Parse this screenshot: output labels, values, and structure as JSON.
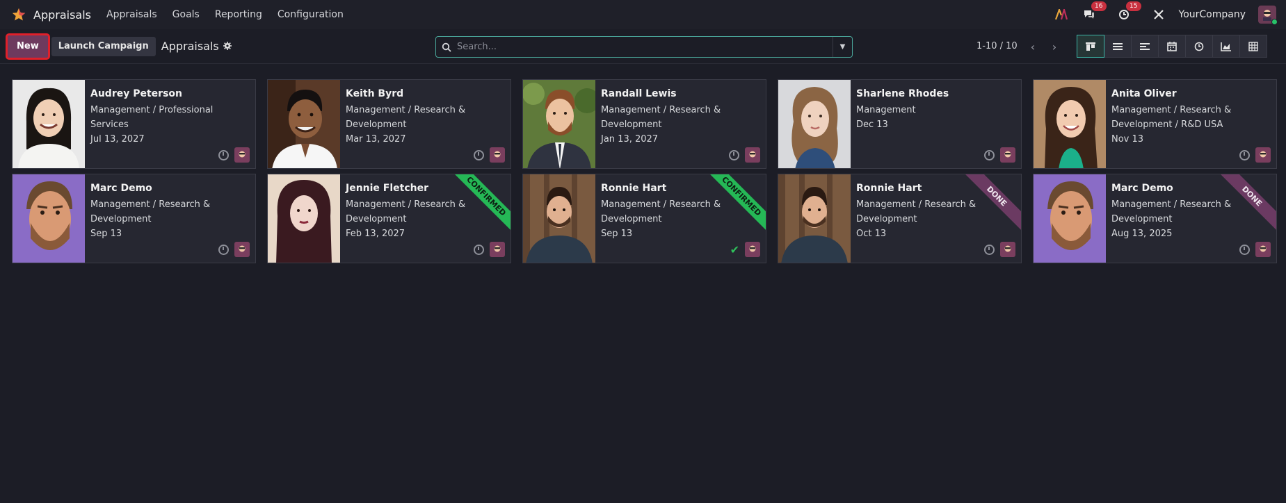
{
  "navbar": {
    "app_title": "Appraisals",
    "menu": [
      "Appraisals",
      "Goals",
      "Reporting",
      "Configuration"
    ],
    "messages_count": "16",
    "activities_count": "15",
    "company": "YourCompany"
  },
  "controls": {
    "new_label": "New",
    "launch_label": "Launch Campaign",
    "breadcrumb": "Appraisals",
    "search_placeholder": "Search...",
    "pager": "1-10 / 10"
  },
  "views": [
    "kanban",
    "list",
    "gantt",
    "calendar",
    "activity",
    "graph",
    "pivot"
  ],
  "colors": {
    "accent": "#6e3a5e",
    "confirmed": "#25b856",
    "done": "#6b3a62",
    "active_view": "#3db8a8"
  },
  "cards": [
    {
      "name": "Audrey Peterson",
      "dept": "Management / Professional Services",
      "date": "Jul 13, 2027",
      "ribbon": "",
      "status_icon": "clock-icon"
    },
    {
      "name": "Keith Byrd",
      "dept": "Management / Research & Development",
      "date": "Mar 13, 2027",
      "ribbon": "",
      "status_icon": "clock-icon"
    },
    {
      "name": "Randall Lewis",
      "dept": "Management / Research & Development",
      "date": "Jan 13, 2027",
      "ribbon": "",
      "status_icon": "clock-icon"
    },
    {
      "name": "Sharlene Rhodes",
      "dept": "Management",
      "date": "Dec 13",
      "ribbon": "",
      "status_icon": "clock-icon"
    },
    {
      "name": "Anita Oliver",
      "dept": "Management / Research & Development / R&D USA",
      "date": "Nov 13",
      "ribbon": "",
      "status_icon": "clock-icon"
    },
    {
      "name": "Marc Demo",
      "dept": "Management / Research & Development",
      "date": "Sep 13",
      "ribbon": "",
      "status_icon": "clock-icon"
    },
    {
      "name": "Jennie Fletcher",
      "dept": "Management / Research & Development",
      "date": "Feb 13, 2027",
      "ribbon": "CONFIRMED",
      "status_icon": "clock-icon"
    },
    {
      "name": "Ronnie Hart",
      "dept": "Management / Research & Development",
      "date": "Sep 13",
      "ribbon": "CONFIRMED",
      "status_icon": "check-icon"
    },
    {
      "name": "Ronnie Hart",
      "dept": "Management / Research & Development",
      "date": "Oct 13",
      "ribbon": "DONE",
      "status_icon": "clock-icon"
    },
    {
      "name": "Marc Demo",
      "dept": "Management / Research & Development",
      "date": "Aug 13, 2025",
      "ribbon": "DONE",
      "status_icon": "clock-icon"
    }
  ]
}
